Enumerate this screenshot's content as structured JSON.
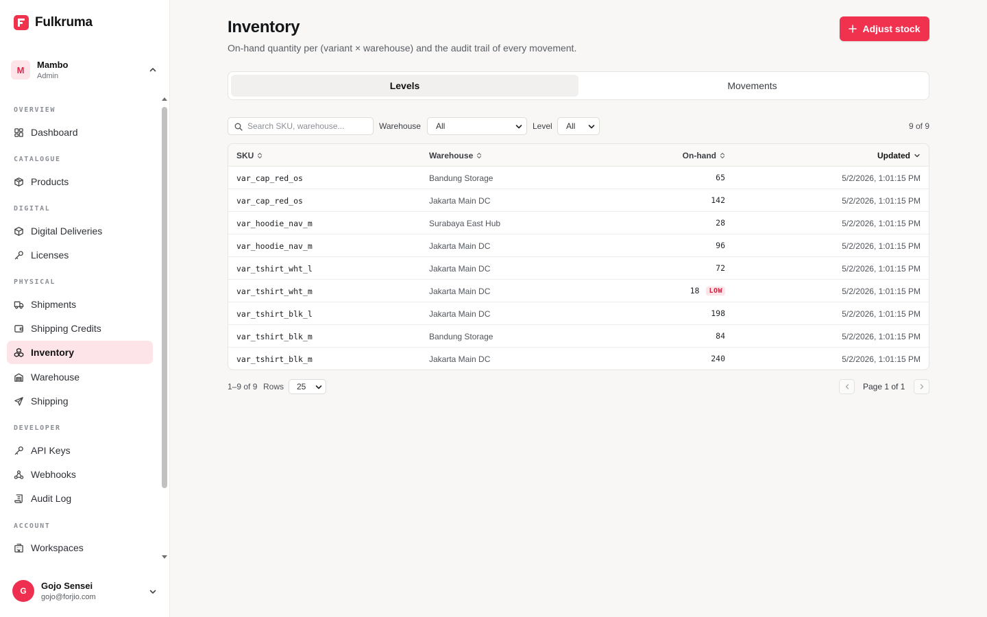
{
  "brand": {
    "name": "Fulkruma"
  },
  "workspace": {
    "initial": "M",
    "name": "Mambo",
    "role": "Admin"
  },
  "nav": {
    "sections": {
      "overview": "OVERVIEW",
      "catalogue": "CATALOGUE",
      "digital": "DIGITAL",
      "physical": "PHYSICAL",
      "developer": "DEVELOPER",
      "account": "ACCOUNT"
    },
    "items": {
      "dashboard": "Dashboard",
      "products": "Products",
      "digital_deliveries": "Digital Deliveries",
      "licenses": "Licenses",
      "shipments": "Shipments",
      "shipping_credits": "Shipping Credits",
      "inventory": "Inventory",
      "warehouse": "Warehouse",
      "shipping": "Shipping",
      "api_keys": "API Keys",
      "webhooks": "Webhooks",
      "audit_log": "Audit Log",
      "workspaces": "Workspaces"
    },
    "active": "inventory"
  },
  "user": {
    "initial": "G",
    "name": "Gojo Sensei",
    "email": "gojo@forjio.com"
  },
  "page": {
    "title": "Inventory",
    "subtitle": "On-hand quantity per (variant × warehouse) and the audit trail of every movement.",
    "primary_action": "Adjust stock"
  },
  "tabs": {
    "levels": "Levels",
    "movements": "Movements",
    "active": "levels"
  },
  "filters": {
    "search_placeholder": "Search SKU, warehouse...",
    "warehouse_label": "Warehouse",
    "warehouse_value": "All",
    "level_label": "Level",
    "level_value": "All",
    "count": "9 of 9"
  },
  "table": {
    "headers": {
      "sku": "SKU",
      "warehouse": "Warehouse",
      "on_hand": "On-hand",
      "updated": "Updated"
    },
    "rows": [
      {
        "sku": "var_cap_red_os",
        "warehouse": "Bandung Storage",
        "on_hand": "65",
        "badge": "",
        "updated": "5/2/2026, 1:01:15 PM"
      },
      {
        "sku": "var_cap_red_os",
        "warehouse": "Jakarta Main DC",
        "on_hand": "142",
        "badge": "",
        "updated": "5/2/2026, 1:01:15 PM"
      },
      {
        "sku": "var_hoodie_nav_m",
        "warehouse": "Surabaya East Hub",
        "on_hand": "28",
        "badge": "",
        "updated": "5/2/2026, 1:01:15 PM"
      },
      {
        "sku": "var_hoodie_nav_m",
        "warehouse": "Jakarta Main DC",
        "on_hand": "96",
        "badge": "",
        "updated": "5/2/2026, 1:01:15 PM"
      },
      {
        "sku": "var_tshirt_wht_l",
        "warehouse": "Jakarta Main DC",
        "on_hand": "72",
        "badge": "",
        "updated": "5/2/2026, 1:01:15 PM"
      },
      {
        "sku": "var_tshirt_wht_m",
        "warehouse": "Jakarta Main DC",
        "on_hand": "18",
        "badge": "LOW",
        "updated": "5/2/2026, 1:01:15 PM"
      },
      {
        "sku": "var_tshirt_blk_l",
        "warehouse": "Jakarta Main DC",
        "on_hand": "198",
        "badge": "",
        "updated": "5/2/2026, 1:01:15 PM"
      },
      {
        "sku": "var_tshirt_blk_m",
        "warehouse": "Bandung Storage",
        "on_hand": "84",
        "badge": "",
        "updated": "5/2/2026, 1:01:15 PM"
      },
      {
        "sku": "var_tshirt_blk_m",
        "warehouse": "Jakarta Main DC",
        "on_hand": "240",
        "badge": "",
        "updated": "5/2/2026, 1:01:15 PM"
      }
    ]
  },
  "pagination": {
    "range": "1–9 of 9",
    "rows_label": "Rows",
    "rows_value": "25",
    "page": "Page 1 of 1"
  },
  "colors": {
    "accent": "#f0324f",
    "active_bg": "#fde4e8",
    "low_badge": "#d81f3d"
  }
}
